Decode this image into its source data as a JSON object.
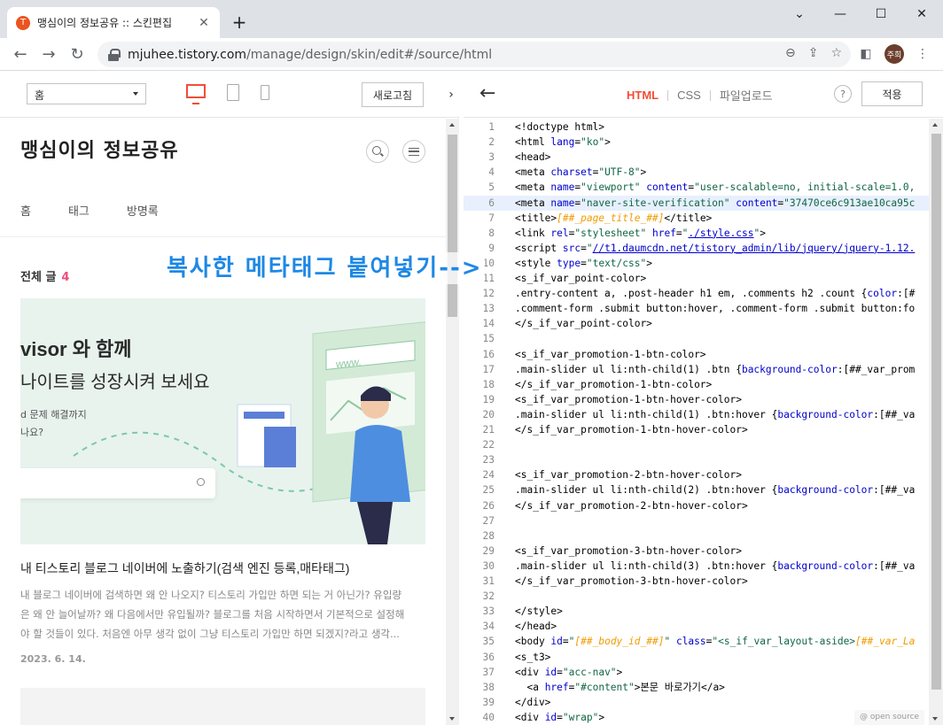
{
  "browser": {
    "tab_title": "맹심이의 정보공유 :: 스킨편집",
    "favicon_glyph": "T",
    "url_host": "mjuhee.tistory.com",
    "url_path": "/manage/design/skin/edit#/source/html",
    "profile_initials": "주희"
  },
  "preview_toolbar": {
    "page_select_value": "홈",
    "refresh_label": "새로고침"
  },
  "blog": {
    "title": "맹심이의 정보공유",
    "nav": [
      "홈",
      "태그",
      "방명록"
    ],
    "all_posts_label": "전체 글",
    "all_posts_count": "4",
    "thumb_line1": "visor 와 함께",
    "thumb_line2": "나이트를 성장시켜 보세요",
    "thumb_line3a": "d 문제 해결까지",
    "thumb_line3b": "나요?",
    "thumb_url_text": "www.",
    "post_title": "내 티스토리 블로그 네이버에 노출하기(검색 엔진 등록,매타태그)",
    "post_excerpt": "내 블로그 네이버에 검색하면 왜 안 나오지? 티스토리 가입만 하면 되는 거 아닌가? 유입량은 왜 안 늘어날까? 왜 다음에서만 유입될까? 블로그를 처음 시작하면서 기본적으로 설정해야 할 것들이 있다. 처음엔 아무 생각 없이 그냥 티스토리 가입만 하면 되겠지?라고 생각...",
    "post_date": "2023. 6. 14."
  },
  "annotation": "복사한 메타태그 붙여넣기-->",
  "editor": {
    "tabs": [
      "HTML",
      "CSS",
      "파일업로드"
    ],
    "active_tab": "HTML",
    "help_label": "?",
    "apply_label": "적용",
    "footer_badge": "@ open source",
    "highlight_line": 6,
    "lines": [
      {
        "n": "1",
        "html": "&lt;!doctype html&gt;"
      },
      {
        "n": "2",
        "html": "&lt;html <span class='c-attr'>lang</span>=<span class='c-str'>\"ko\"</span>&gt;"
      },
      {
        "n": "3",
        "html": "&lt;head&gt;"
      },
      {
        "n": "4",
        "html": "&lt;meta <span class='c-attr'>charset</span>=<span class='c-str'>\"UTF-8\"</span>&gt;"
      },
      {
        "n": "5",
        "html": "&lt;meta <span class='c-attr'>name</span>=<span class='c-str'>\"viewport\"</span> <span class='c-attr'>content</span>=<span class='c-str'>\"user-scalable=no, initial-scale=1.0,</span>"
      },
      {
        "n": "6",
        "html": "&lt;meta <span class='c-attr'>name</span>=<span class='c-str'>\"naver-site-verification\"</span> <span class='c-attr'>content</span>=<span class='c-str'>\"37470ce6c913ae10ca95c</span>"
      },
      {
        "n": "7",
        "html": "&lt;title&gt;<span class='c-var'>[##_page_title_##]</span>&lt;/title&gt;"
      },
      {
        "n": "8",
        "html": "&lt;link <span class='c-attr'>rel</span>=<span class='c-str'>\"stylesheet\"</span> <span class='c-attr'>href</span>=<span class='c-str'>\"<span class='c-url'>./style.css</span>\"</span>&gt;"
      },
      {
        "n": "9",
        "html": "&lt;script <span class='c-attr'>src</span>=<span class='c-str'>\"<span class='c-url'>//t1.daumcdn.net/tistory_admin/lib/jquery/jquery-1.12.</span></span>"
      },
      {
        "n": "10",
        "html": "&lt;style <span class='c-attr'>type</span>=<span class='c-str'>\"text/css\"</span>&gt;"
      },
      {
        "n": "11",
        "html": "&lt;s_if_var_point-color&gt;"
      },
      {
        "n": "12",
        "html": ".entry-content a, .post-header h1 em, .comments h2 .count {<span class='c-attr'>color</span>:[#"
      },
      {
        "n": "13",
        "html": ".comment-form .submit button:hover, .comment-form .submit button:fo"
      },
      {
        "n": "14",
        "html": "&lt;/s_if_var_point-color&gt;"
      },
      {
        "n": "15",
        "html": ""
      },
      {
        "n": "16",
        "html": "&lt;s_if_var_promotion-1-btn-color&gt;"
      },
      {
        "n": "17",
        "html": ".main-slider ul li:nth-child(1) .btn {<span class='c-attr'>background-color</span>:[##_var_prom"
      },
      {
        "n": "18",
        "html": "&lt;/s_if_var_promotion-1-btn-color&gt;"
      },
      {
        "n": "19",
        "html": "&lt;s_if_var_promotion-1-btn-hover-color&gt;"
      },
      {
        "n": "20",
        "html": ".main-slider ul li:nth-child(1) .btn:hover {<span class='c-attr'>background-color</span>:[##_va"
      },
      {
        "n": "21",
        "html": "&lt;/s_if_var_promotion-1-btn-hover-color&gt;"
      },
      {
        "n": "22",
        "html": ""
      },
      {
        "n": "23",
        "html": ""
      },
      {
        "n": "24",
        "html": "&lt;s_if_var_promotion-2-btn-hover-color&gt;"
      },
      {
        "n": "25",
        "html": ".main-slider ul li:nth-child(2) .btn:hover {<span class='c-attr'>background-color</span>:[##_va"
      },
      {
        "n": "26",
        "html": "&lt;/s_if_var_promotion-2-btn-hover-color&gt;"
      },
      {
        "n": "27",
        "html": ""
      },
      {
        "n": "28",
        "html": ""
      },
      {
        "n": "29",
        "html": "&lt;s_if_var_promotion-3-btn-hover-color&gt;"
      },
      {
        "n": "30",
        "html": ".main-slider ul li:nth-child(3) .btn:hover {<span class='c-attr'>background-color</span>:[##_va"
      },
      {
        "n": "31",
        "html": "&lt;/s_if_var_promotion-3-btn-hover-color&gt;"
      },
      {
        "n": "32",
        "html": ""
      },
      {
        "n": "33",
        "html": "&lt;/style&gt;"
      },
      {
        "n": "34",
        "html": "&lt;/head&gt;"
      },
      {
        "n": "35",
        "html": "&lt;body <span class='c-attr'>id</span>=<span class='c-str'>\"<span class='c-var'>[##_body_id_##]</span>\"</span> <span class='c-attr'>class</span>=<span class='c-str'>\"&lt;s_if_var_layout-aside&gt;<span class='c-var'>[##_var_La</span></span>"
      },
      {
        "n": "36",
        "html": "&lt;s_t3&gt;"
      },
      {
        "n": "37",
        "html": "&lt;div <span class='c-attr'>id</span>=<span class='c-str'>\"acc-nav\"</span>&gt;"
      },
      {
        "n": "38",
        "html": "  &lt;a <span class='c-attr'>href</span>=<span class='c-str'>\"#content\"</span>&gt;본문 바로가기&lt;/a&gt;"
      },
      {
        "n": "39",
        "html": "&lt;/div&gt;"
      },
      {
        "n": "40",
        "html": "&lt;div <span class='c-attr'>id</span>=<span class='c-str'>\"wrap\"</span>&gt;"
      }
    ]
  },
  "colors": {
    "accent": "#f04e37",
    "annotation_blue": "#1e88e5",
    "count_pink": "#f04e7d"
  }
}
